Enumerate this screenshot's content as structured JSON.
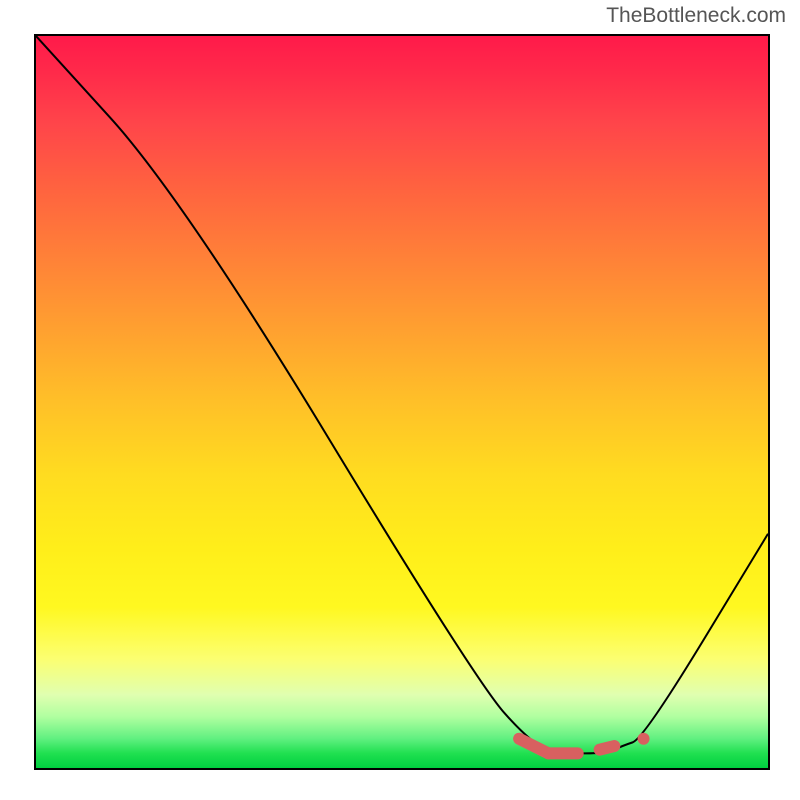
{
  "watermark": "TheBottleneck.com",
  "chart_data": {
    "type": "line",
    "title": "",
    "xlabel": "",
    "ylabel": "",
    "xlim": [
      0,
      100
    ],
    "ylim": [
      0,
      100
    ],
    "series": [
      {
        "name": "bottleneck-curve",
        "x": [
          0,
          20,
          60,
          68,
          72,
          78,
          80,
          83,
          100
        ],
        "y": [
          100,
          78,
          12,
          3,
          2,
          2,
          3,
          4,
          32
        ]
      }
    ],
    "highlight_region": {
      "name": "optimal-zone",
      "color": "#d86060",
      "segments": [
        {
          "x": [
            66,
            70
          ],
          "y": [
            4,
            2
          ],
          "thick": true
        },
        {
          "x": [
            70,
            74
          ],
          "y": [
            2,
            2
          ],
          "thick": true
        },
        {
          "x": [
            77,
            79
          ],
          "y": [
            2.5,
            3
          ],
          "thick": true
        }
      ],
      "dot": {
        "x": 83,
        "y": 4
      }
    },
    "background_gradient": {
      "stops": [
        {
          "pos": 0,
          "color": "#ff1a4a",
          "meaning": "severe"
        },
        {
          "pos": 50,
          "color": "#ffc028",
          "meaning": "moderate"
        },
        {
          "pos": 85,
          "color": "#fcff70",
          "meaning": "mild"
        },
        {
          "pos": 100,
          "color": "#00d040",
          "meaning": "optimal"
        }
      ]
    }
  }
}
